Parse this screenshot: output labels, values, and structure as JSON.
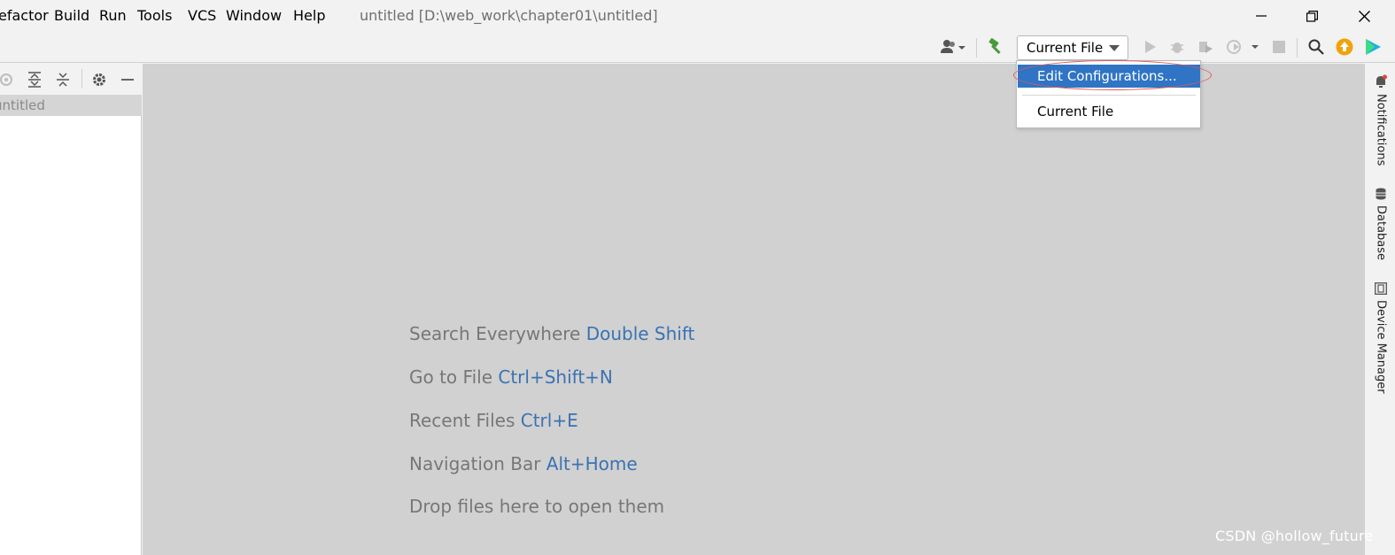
{
  "window": {
    "title": "untitled [D:\\web_work\\chapter01\\untitled]",
    "controls": [
      "minimize-icon",
      "restore-icon",
      "close-icon"
    ]
  },
  "menu": {
    "items": [
      "efactor",
      "Build",
      "Run",
      "Tools",
      "VCS",
      "Window",
      "Help"
    ]
  },
  "toolbar": {
    "run_config_label": "Current File",
    "icons": [
      "user-icon",
      "build-hammer-icon",
      "run-icon",
      "debug-icon",
      "coverage-icon",
      "profile-icon",
      "stop-icon",
      "search-icon",
      "update-icon",
      "jetbrains-toolbox-icon"
    ]
  },
  "run_dropdown": {
    "items": [
      {
        "label": "Edit Configurations...",
        "selected": true
      },
      {
        "label": "Current File",
        "selected": false
      }
    ]
  },
  "project_panel": {
    "tree_root": "untitled",
    "icons": [
      "locate-icon",
      "expand-all-icon",
      "collapse-all-icon",
      "settings-gear-icon",
      "hide-icon"
    ]
  },
  "editor": {
    "hints": [
      {
        "text": "Search Everywhere",
        "shortcut": "Double Shift"
      },
      {
        "text": "Go to File",
        "shortcut": "Ctrl+Shift+N"
      },
      {
        "text": "Recent Files",
        "shortcut": "Ctrl+E"
      },
      {
        "text": "Navigation Bar",
        "shortcut": "Alt+Home"
      },
      {
        "text": "Drop files here to open them",
        "shortcut": ""
      }
    ]
  },
  "right_sidebar": {
    "tabs": [
      "Notifications",
      "Database",
      "Device Manager"
    ]
  },
  "watermark": "CSDN @hollow_future",
  "colors": {
    "accent": "#2f74c5",
    "shortcut": "#3b72b2",
    "highlight_ring": "#e05a5a",
    "build_green": "#4a9a3c",
    "update_orange": "#f0a30a"
  }
}
